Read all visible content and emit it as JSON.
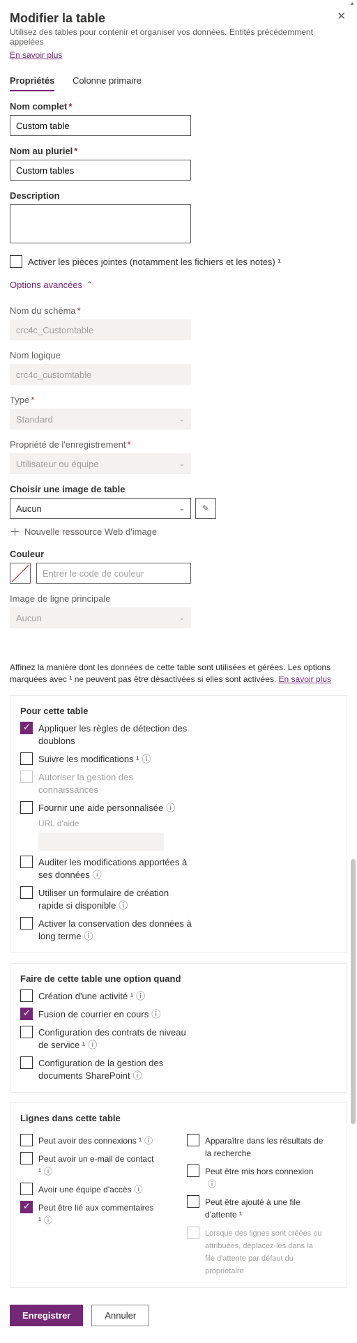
{
  "header": {
    "title": "Modifier la table",
    "subtitle": "Utilisez des tables pour contenir et organiser vos données. Entités précédemment appelées",
    "learn_more": "En savoir plus"
  },
  "tabs": {
    "properties": "Propriétés",
    "primary_column": "Colonne primaire"
  },
  "fields": {
    "display_name": {
      "label": "Nom complet",
      "value": "Custom table"
    },
    "plural_name": {
      "label": "Nom au pluriel",
      "value": "Custom tables"
    },
    "description": {
      "label": "Description",
      "value": ""
    },
    "attachments": {
      "label": "Activer les pièces jointes (notamment les fichiers et les notes) ¹"
    },
    "advanced_toggle": "Options avancées",
    "schema_name": {
      "label": "Nom du schéma",
      "value": "crc4c_Customtable"
    },
    "logical_name": {
      "label": "Nom logique",
      "value": "crc4c_customtable"
    },
    "type": {
      "label": "Type",
      "value": "Standard"
    },
    "ownership": {
      "label": "Propriété de l'enregistrement",
      "value": "Utilisateur ou équipe"
    },
    "table_image": {
      "label": "Choisir une image de table",
      "value": "Aucun"
    },
    "new_web_resource": "Nouvelle ressource Web d'image",
    "color": {
      "label": "Couleur",
      "placeholder": "Entrer le code de couleur"
    },
    "primary_image": {
      "label": "Image de ligne principale",
      "value": "Aucun"
    }
  },
  "refine": {
    "text_a": "Affinez la manière dont les données de cette table sont utilisées et gérées. Les options marquées avec ¹ ne peuvent pas être désactivées si elles sont activées. ",
    "learn_more": "En savoir plus"
  },
  "card_table": {
    "title": "Pour cette table",
    "dup_detection": "Appliquer les règles de détection des doublons",
    "track_changes": "Suivre les modifications ¹",
    "knowledge": "Autoriser la gestion des connaissances",
    "custom_help": "Fournir une aide personnalisée",
    "help_url_label": "URL d'aide",
    "audit": "Auditer les modifications apportées à ses données",
    "quick_create": "Utiliser un formulaire de création rapide si disponible",
    "retention": "Activer la conservation des données à long terme"
  },
  "card_option": {
    "title": "Faire de cette table une option quand",
    "activity": "Création d'une activité ¹",
    "mail_merge": "Fusion de courrier en cours",
    "sla": "Configuration des contrats de niveau de service ¹",
    "sharepoint": "Configuration de la gestion des documents SharePoint"
  },
  "card_rows": {
    "title": "Lignes dans cette table",
    "connections": "Peut avoir des connexions ¹",
    "contact_email": "Peut avoir un e-mail de contact ¹",
    "access_team": "Avoir une équipe d'accès",
    "feedback": "Peut être lié aux commentaires ¹",
    "search": "Apparaître dans les résultats de la recherche",
    "offline": "Peut être mis hors connexion",
    "queue": "Peut être ajouté à une file d'attente ¹",
    "queue_note": "Lorsque des lignes sont créées ou attribuées, déplacez-les dans la file d'attente par défaut du propriétaire"
  },
  "footer": {
    "save": "Enregistrer",
    "cancel": "Annuler"
  }
}
